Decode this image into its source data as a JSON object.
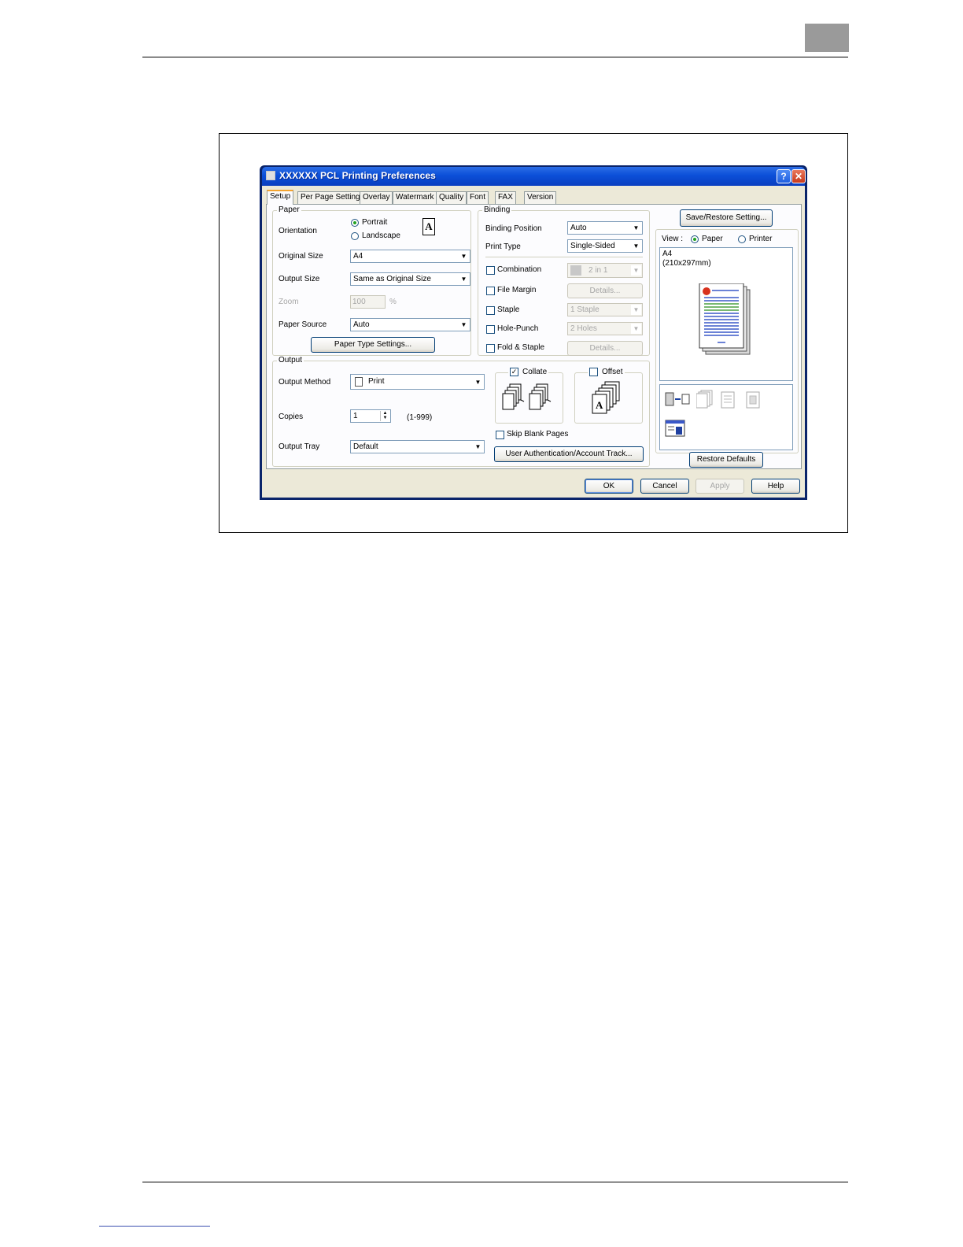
{
  "window": {
    "title": "XXXXXX PCL Printing Preferences",
    "help_glyph": "?",
    "close_glyph": "✕"
  },
  "tabs": [
    "Setup",
    "Per Page Setting",
    "Overlay",
    "Watermark",
    "Quality",
    "Font",
    "FAX",
    "Version"
  ],
  "paper": {
    "legend": "Paper",
    "orientation_label": "Orientation",
    "portrait_label": "Portrait",
    "landscape_label": "Landscape",
    "orientation_glyph": "A",
    "original_size_label": "Original Size",
    "original_size_value": "A4",
    "output_size_label": "Output Size",
    "output_size_value": "Same as Original Size",
    "zoom_label": "Zoom",
    "zoom_value": "100",
    "zoom_unit": "%",
    "paper_source_label": "Paper Source",
    "paper_source_value": "Auto",
    "paper_type_button": "Paper Type Settings..."
  },
  "binding": {
    "legend": "Binding",
    "binding_position_label": "Binding Position",
    "binding_position_value": "Auto",
    "print_type_label": "Print Type",
    "print_type_value": "Single-Sided",
    "combination_label": "Combination",
    "combination_value": "2 in 1",
    "file_margin_label": "File Margin",
    "file_margin_button": "Details...",
    "staple_label": "Staple",
    "staple_value": "1 Staple",
    "hole_punch_label": "Hole-Punch",
    "hole_punch_value": "2 Holes",
    "fold_staple_label": "Fold & Staple",
    "fold_staple_button": "Details..."
  },
  "output": {
    "legend": "Output",
    "output_method_label": "Output Method",
    "output_method_value": "Print",
    "copies_label": "Copies",
    "copies_value": "1",
    "copies_range": "(1-999)",
    "output_tray_label": "Output Tray",
    "output_tray_value": "Default",
    "collate_label": "Collate",
    "collate_checked": true,
    "offset_label": "Offset",
    "skip_blank_label": "Skip Blank Pages",
    "user_auth_button": "User Authentication/Account Track...",
    "offset_glyph": "A"
  },
  "preview": {
    "save_restore_button": "Save/Restore Setting...",
    "view_label": "View :",
    "paper_option": "Paper",
    "printer_option": "Printer",
    "paper_size": "A4",
    "paper_dims": "(210x297mm)",
    "restore_defaults_button": "Restore Defaults"
  },
  "footer_buttons": {
    "ok": "OK",
    "cancel": "Cancel",
    "apply": "Apply",
    "help": "Help"
  }
}
